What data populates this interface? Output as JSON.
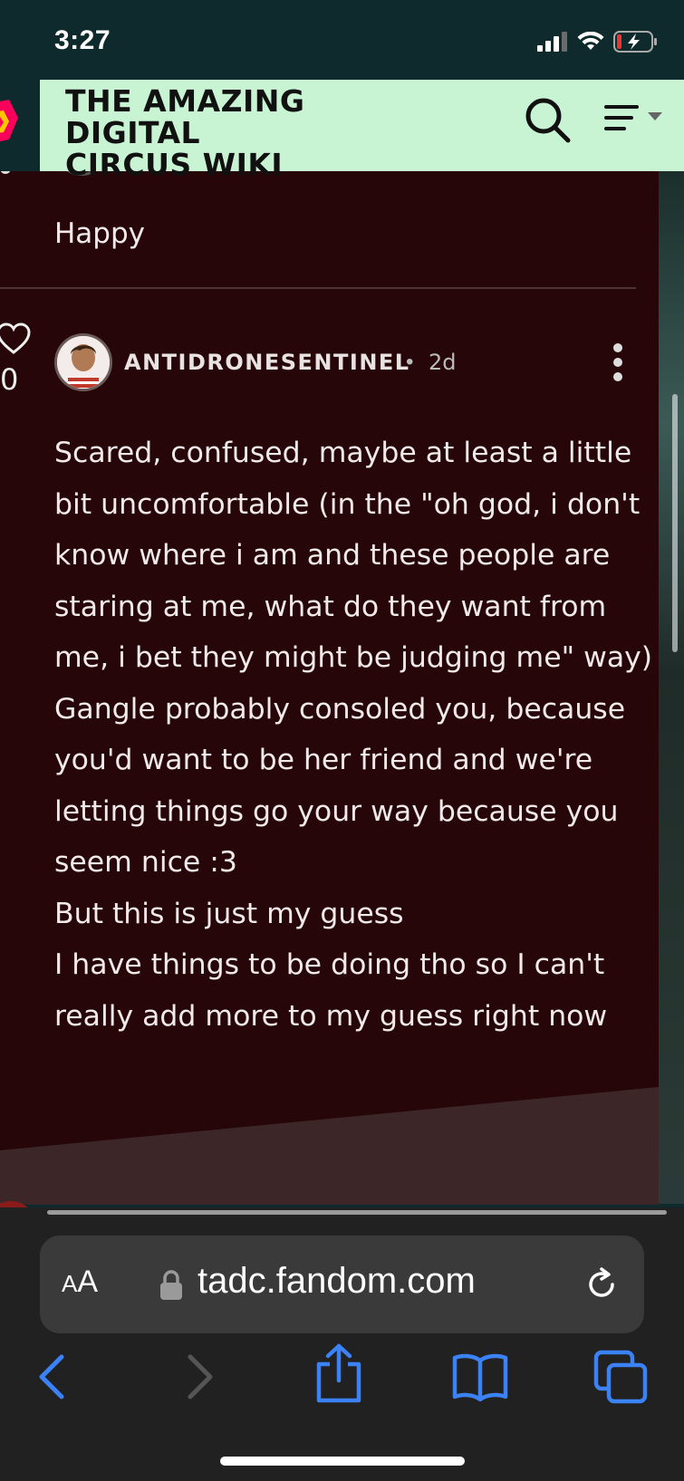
{
  "status_bar": {
    "time": "3:27",
    "icons": [
      "cellular-signal-icon",
      "wifi-icon",
      "battery-charging-icon"
    ]
  },
  "wiki_header": {
    "title_line1": "THE AMAZING DIGITAL",
    "title_line2": "CIRCUS WIKI",
    "background": "#c8f4d3",
    "icons": [
      "fandom-logo-icon",
      "search-icon",
      "menu-icon"
    ]
  },
  "previous_comment": {
    "text": "Happy"
  },
  "comment": {
    "likes": "0",
    "author": "ANTIDRONESENTINEL",
    "separator": "•",
    "time_ago": "2d",
    "lines": [
      "Scared, confused, maybe at least a little",
      "bit uncomfortable (in the \"oh god, i don't",
      "know where i am and these people are",
      "staring at me, what do they want from",
      "me, i bet they might be judging me\" way)",
      "Gangle probably consoled you, because",
      "you'd want to be her friend and we're",
      "letting things go your way because you",
      "seem nice :3",
      "But this is just my guess",
      "I have things to be doing tho so I can't",
      "really add more to my guess right now"
    ]
  },
  "browser": {
    "aa_label_big": "A",
    "aa_label_small": "A",
    "url": "tadc.fandom.com",
    "accent": "#3b82f6",
    "icons": [
      "back-icon",
      "forward-icon",
      "share-icon",
      "bookmarks-icon",
      "tabs-icon",
      "lock-icon",
      "reload-icon"
    ]
  },
  "colors": {
    "panel": "#260608",
    "status_bar": "#0f2a2c"
  }
}
